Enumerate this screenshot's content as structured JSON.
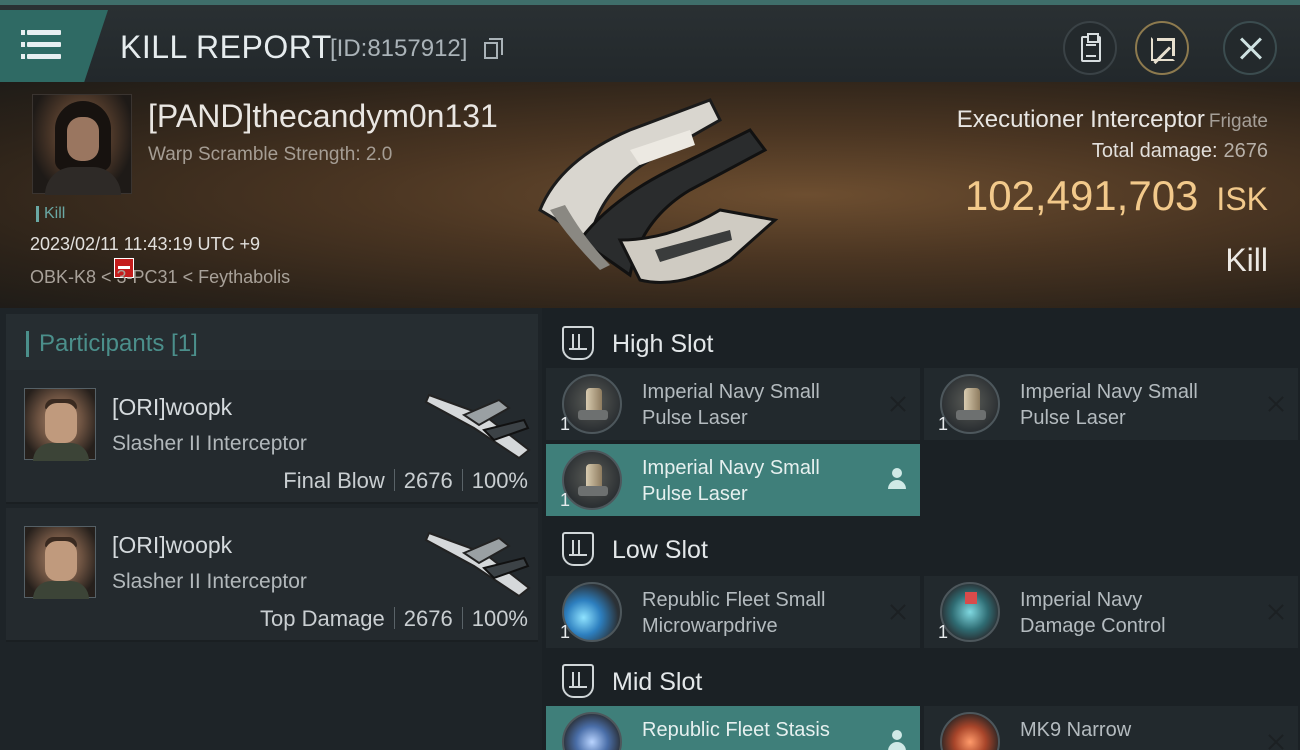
{
  "header": {
    "title": "KILL REPORT",
    "report_id": "[ID:8157912]"
  },
  "victim": {
    "name": "[PAND]thecandym0n131",
    "warp_scramble": "Warp Scramble Strength: 2.0",
    "tag": "Kill",
    "time": "2023/02/11 11:43:19 UTC +9",
    "location": "OBK-K8 < 3-PC31 < Feythabolis",
    "ship": "Executioner Interceptor",
    "ship_class": "Frigate",
    "total_damage_label": "Total damage:",
    "total_damage": "2676",
    "isk_value": "102,491,703",
    "isk_unit": "ISK",
    "result": "Kill"
  },
  "participants": {
    "title": "Participants [1]",
    "rows": [
      {
        "name": "[ORI]woopk",
        "ship": "Slasher II Interceptor",
        "role": "Final Blow",
        "damage": "2676",
        "percent": "100%"
      },
      {
        "name": "[ORI]woopk",
        "ship": "Slasher II Interceptor",
        "role": "Top Damage",
        "damage": "2676",
        "percent": "100%"
      }
    ]
  },
  "fitting": {
    "high_slot": {
      "label": "High Slot",
      "modules": [
        {
          "name_line1": "Imperial Navy Small",
          "name_line2": "Pulse Laser",
          "qty": "1",
          "state": "destroyed"
        },
        {
          "name_line1": "Imperial Navy Small",
          "name_line2": "Pulse Laser",
          "qty": "1",
          "state": "destroyed"
        },
        {
          "name_line1": "Imperial Navy Small",
          "name_line2": "Pulse Laser",
          "qty": "1",
          "state": "dropped"
        }
      ]
    },
    "low_slot": {
      "label": "Low Slot",
      "modules": [
        {
          "name_line1": "Republic Fleet Small",
          "name_line2": "Microwarpdrive",
          "qty": "1",
          "state": "destroyed"
        },
        {
          "name_line1": "Imperial Navy",
          "name_line2": "Damage Control",
          "qty": "1",
          "state": "destroyed"
        }
      ]
    },
    "mid_slot": {
      "label": "Mid Slot",
      "modules": [
        {
          "name_line1": "Republic Fleet Stasis",
          "name_line2": "",
          "state": "dropped"
        },
        {
          "name_line1": "MK9 Narrow",
          "name_line2": "",
          "state": "destroyed"
        }
      ]
    }
  },
  "colors": {
    "accent_teal": "#3f7f7a",
    "isk_gold": "#f2c98b",
    "corp_badge_red": "#c41d1d"
  }
}
